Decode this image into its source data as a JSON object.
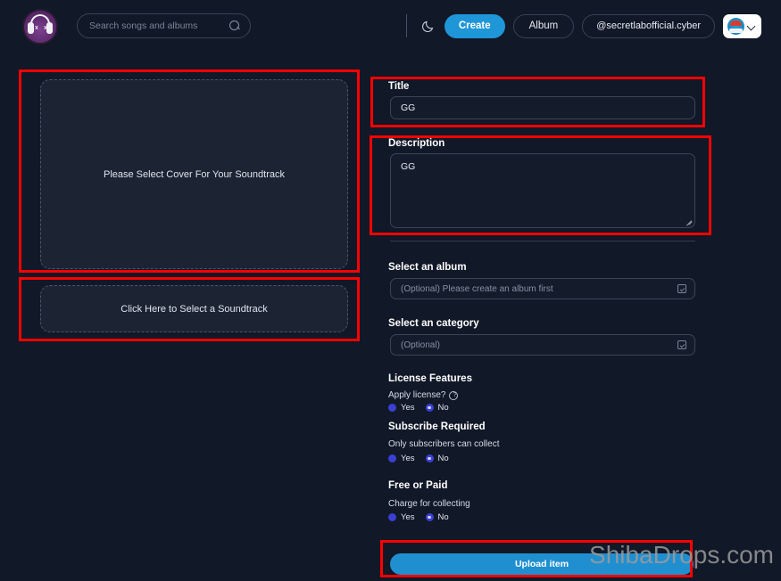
{
  "header": {
    "brand_icon": "headphones-avatar-icon",
    "search": {
      "placeholder": "Search songs and albums",
      "value": "",
      "icon": "search-icon"
    },
    "theme_toggle_icon": "moon-icon",
    "create_label": "Create",
    "album_label": "Album",
    "handle_label": "@secretlabofficial.cyber",
    "user_menu_icon": "chevron-down-icon",
    "user_avatar_icon": "user-avatar-icon"
  },
  "left_panel": {
    "cover_dropzone_label": "Please Select Cover For Your Soundtrack",
    "track_dropzone_label": "Click Here to Select a Soundtrack"
  },
  "form": {
    "title_label": "Title",
    "title_value": "GG",
    "description_label": "Description",
    "description_value": "GG",
    "album_label": "Select an album",
    "album_value": "(Optional) Please create an album first",
    "category_label": "Select an category",
    "category_value": "(Optional)",
    "select_icon": "select-dropdown-icon",
    "license": {
      "heading": "License Features",
      "question": "Apply license?",
      "help_icon": "help-circle-icon",
      "yes_label": "Yes",
      "no_label": "No",
      "selected": "No"
    },
    "subscribe": {
      "heading": "Subscribe Required",
      "question": "Only subscribers can collect",
      "yes_label": "Yes",
      "no_label": "No",
      "selected": "No"
    },
    "paid": {
      "heading": "Free or Paid",
      "question": "Charge for collecting",
      "yes_label": "Yes",
      "no_label": "No",
      "selected": "No"
    },
    "submit_label": "Upload item"
  },
  "watermark": "ShibaDrops.com",
  "colors": {
    "background": "#111827",
    "panel": "#1c2433",
    "accent_blue": "#1f96d8",
    "radio_blue": "#3b3fd4",
    "annotation_red": "#fe0000"
  }
}
